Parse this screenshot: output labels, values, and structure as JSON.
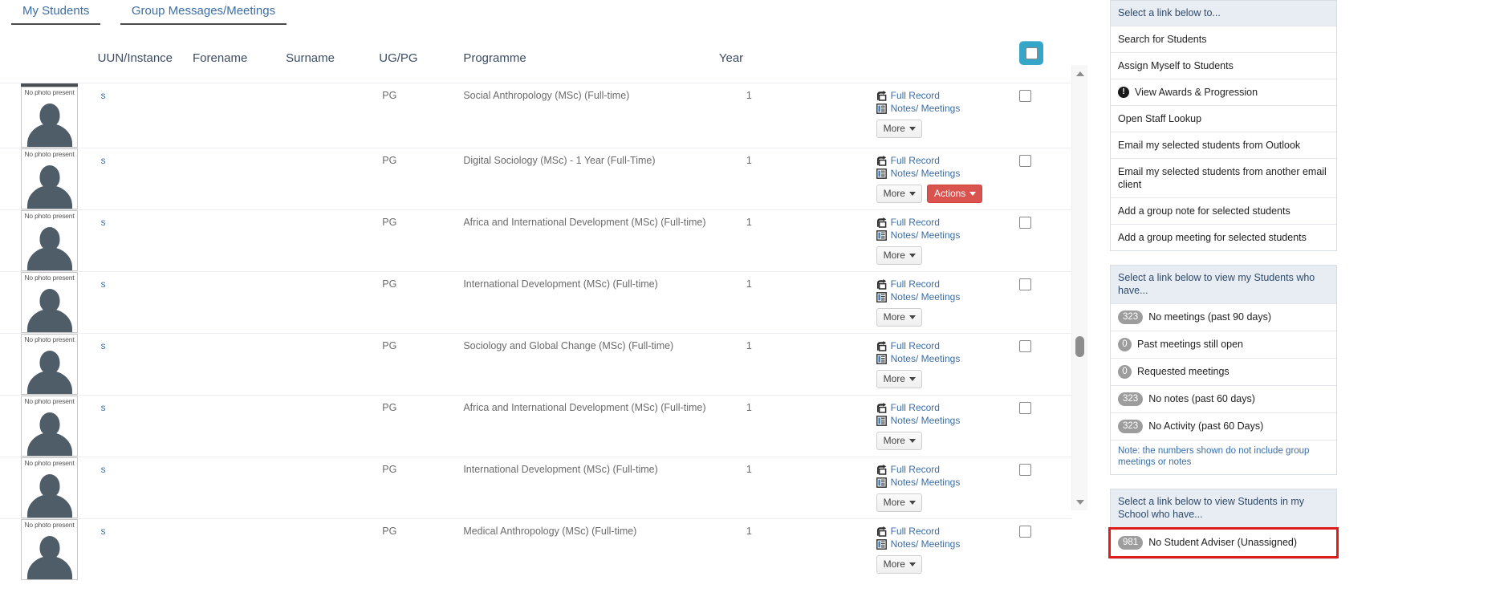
{
  "tabs": [
    {
      "label": "My Students",
      "active": true
    },
    {
      "label": "Group Messages/Meetings",
      "active": false
    }
  ],
  "table": {
    "columns": [
      "",
      "UUN/Instance",
      "Forename",
      "Surname",
      "UG/PG",
      "Programme",
      "Year",
      "",
      ""
    ],
    "photo_placeholder": "No photo present",
    "uun_link_text": "s",
    "links": {
      "full_record": "Full Record",
      "notes_meetings": "Notes/ Meetings",
      "more": "More",
      "actions": "Actions"
    },
    "rows": [
      {
        "uun": "s",
        "forename": "",
        "surname": "",
        "ugpg": "PG",
        "programme": "Social Anthropology (MSc) (Full-time)",
        "year": "1",
        "has_actions": false,
        "checked": false
      },
      {
        "uun": "s",
        "forename": "",
        "surname": "",
        "ugpg": "PG",
        "programme": "Digital Sociology (MSc) - 1 Year (Full-Time)",
        "year": "1",
        "has_actions": true,
        "checked": false
      },
      {
        "uun": "s",
        "forename": "",
        "surname": "",
        "ugpg": "PG",
        "programme": "Africa and International Development (MSc) (Full-time)",
        "year": "1",
        "has_actions": false,
        "checked": false
      },
      {
        "uun": "s",
        "forename": "",
        "surname": "",
        "ugpg": "PG",
        "programme": "International Development (MSc) (Full-time)",
        "year": "1",
        "has_actions": false,
        "checked": false
      },
      {
        "uun": "s",
        "forename": "",
        "surname": "",
        "ugpg": "PG",
        "programme": "Sociology and Global Change (MSc) (Full-time)",
        "year": "1",
        "has_actions": false,
        "checked": false
      },
      {
        "uun": "s",
        "forename": "",
        "surname": "",
        "ugpg": "PG",
        "programme": "Africa and International Development (MSc) (Full-time)",
        "year": "1",
        "has_actions": false,
        "checked": false
      },
      {
        "uun": "s",
        "forename": "",
        "surname": "",
        "ugpg": "PG",
        "programme": "International Development (MSc) (Full-time)",
        "year": "1",
        "has_actions": false,
        "checked": false
      },
      {
        "uun": "s",
        "forename": "",
        "surname": "",
        "ugpg": "PG",
        "programme": "Medical Anthropology (MSc) (Full-time)",
        "year": "1",
        "has_actions": false,
        "checked": false
      }
    ]
  },
  "panels": {
    "actions": {
      "heading": "Select a link below to...",
      "items": [
        {
          "label": "Search for Students",
          "icon": null
        },
        {
          "label": "Assign Myself to Students",
          "icon": null
        },
        {
          "label": "View Awards & Progression",
          "icon": "warning-icon"
        },
        {
          "label": "Open Staff Lookup",
          "icon": null
        },
        {
          "label": "Email my selected students from Outlook",
          "icon": null
        },
        {
          "label": "Email my selected students from another email client",
          "icon": null
        },
        {
          "label": "Add a group note for selected students",
          "icon": null
        },
        {
          "label": "Add a group meeting for selected students",
          "icon": null
        }
      ]
    },
    "my_students": {
      "heading": "Select a link below to view my Students who have...",
      "items": [
        {
          "count": "323",
          "label": "No meetings (past 90 days)"
        },
        {
          "count": "0",
          "label": "Past meetings still open"
        },
        {
          "count": "0",
          "label": "Requested meetings"
        },
        {
          "count": "323",
          "label": "No notes (past 60 days)"
        },
        {
          "count": "323",
          "label": "No Activity (past 60 Days)"
        }
      ],
      "note": "Note: the numbers shown do not include group meetings or notes"
    },
    "school_students": {
      "heading": "Select a link below to view Students in my School who have...",
      "items": [
        {
          "count": "981",
          "label": "No Student Adviser (Unassigned)",
          "highlighted": true
        }
      ]
    }
  },
  "colors": {
    "accent_blue": "#3b6ea5",
    "checkbox_active": "#35a5c8",
    "actions_red": "#d9534f",
    "highlight_red": "#e01b1b",
    "panel_header": "#e8edf3",
    "badge_grey": "#9d9d9d"
  }
}
